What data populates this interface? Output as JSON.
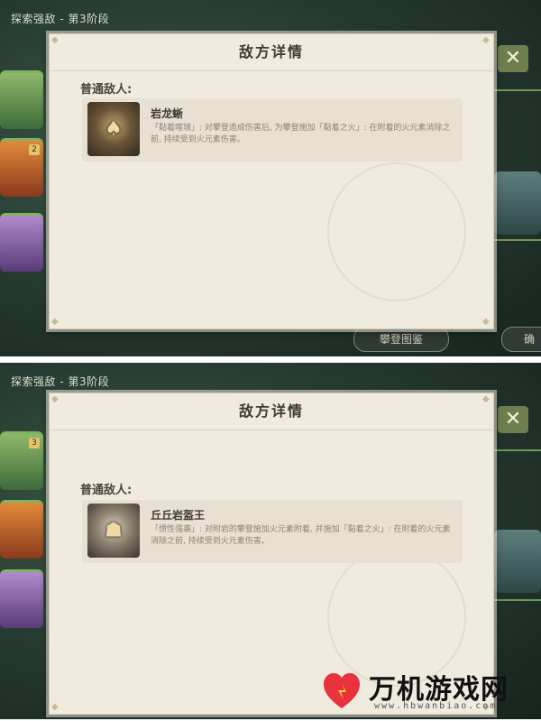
{
  "screens": [
    {
      "breadcrumb": "探索强敌 - 第3阶段",
      "char_badges": [
        "",
        "2",
        ""
      ],
      "panel_title": "敌方详情",
      "section_title": "普通敌人:",
      "enemy": {
        "name": "岩龙蜥",
        "description": "「黏着喀琅」: 对攀登造成伤害后, 为攀登施加「黏着之火」: 在附着的火元素消除之前, 持续受到火元素伤害。"
      },
      "buttons": {
        "encyclopedia": "攀登图鉴",
        "right_partial": "确"
      },
      "close_icon": "close-icon"
    },
    {
      "breadcrumb": "探索强敌 - 第3阶段",
      "char_badges": [
        "3",
        "",
        ""
      ],
      "panel_title": "敌方详情",
      "section_title": "普通敌人:",
      "enemy": {
        "name": "丘丘岩盔王",
        "description": "「惯性强袭」: 对附岩的攀登施加火元素附着, 并施加「黏着之火」: 在附着的火元素消除之前, 持续受到火元素伤害。"
      },
      "close_icon": "close-icon"
    }
  ],
  "watermark": {
    "name": "万机游戏网",
    "url": "www.hbwanbiao.com"
  },
  "colors": {
    "panel": "#f0ebdf",
    "accent_green": "#6e7f4e",
    "logo_red": "#e8323c"
  }
}
